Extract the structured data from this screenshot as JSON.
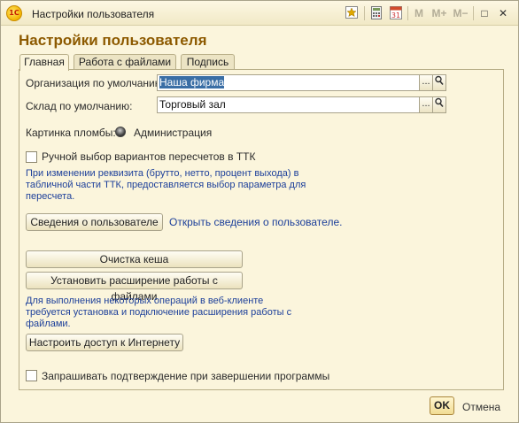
{
  "window": {
    "title": "Настройки пользователя",
    "app_icon_text": "1С",
    "toolbar": {
      "memory_m": "M",
      "memory_mplus": "M+",
      "memory_mminus": "M−",
      "minimize": "—",
      "maximize": "□",
      "close": "✕"
    }
  },
  "form": {
    "heading": "Настройки пользователя",
    "tabs": [
      {
        "label": "Главная",
        "active": true
      },
      {
        "label": "Работа с файлами",
        "active": false
      },
      {
        "label": "Подпись",
        "active": false
      }
    ],
    "org": {
      "label": "Организация по умолчанию:",
      "value": "Наша фирма"
    },
    "warehouse": {
      "label": "Склад по умолчанию:",
      "value": "Торговый зал"
    },
    "select_button": "...",
    "seal": {
      "label": "Картинка пломбы:",
      "value": "Администрация"
    },
    "manual_choice": {
      "label": "Ручной выбор вариантов пересчетов в ТТК",
      "checked": false
    },
    "manual_note": [
      "При изменении реквизита (брутто, нетто, процент выхода) в",
      "табличной части ТТК, предоставляется выбор параметра для",
      "пересчета."
    ],
    "user_info_button": "Сведения о пользователе",
    "user_info_link": "Открыть сведения о пользователе.",
    "clear_cache_button": "Очистка кеша",
    "install_ext_button": "Установить расширение работы с файлами",
    "ext_note": [
      "Для выполнения некоторых операций в веб-клиенте",
      "требуется установка и подключение расширения работы с",
      "файлами."
    ],
    "internet_button": "Настроить доступ к Интернету",
    "confirm_exit": {
      "label": "Запрашивать подтверждение при завершении программы",
      "checked": false
    }
  },
  "footer": {
    "ok": "OK",
    "cancel": "Отмена"
  }
}
